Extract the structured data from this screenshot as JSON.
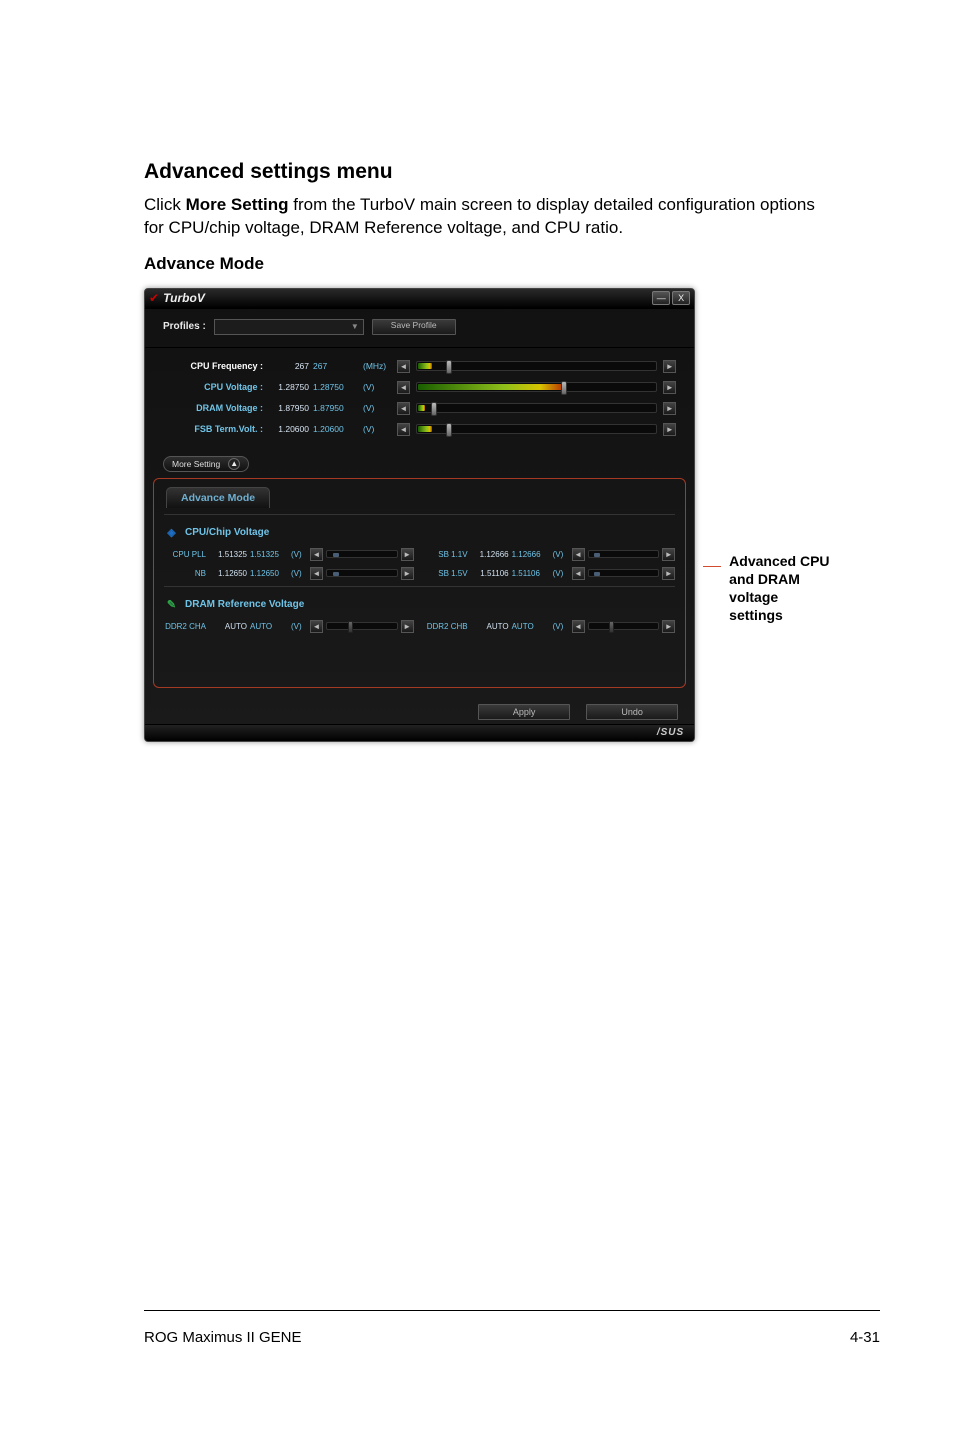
{
  "page": {
    "heading": "Advanced settings menu",
    "desc_prefix": "Click ",
    "desc_strong": "More Setting",
    "desc_suffix": " from the TurboV main screen to display detailed configuration options for CPU/chip voltage, DRAM Reference voltage, and CPU ratio.",
    "sub_heading": "Advance Mode",
    "callout": "Advanced CPU and DRAM voltage settings",
    "footer_left": "ROG Maximus II GENE",
    "footer_right": "4-31"
  },
  "titlebar": {
    "title": "TurboV",
    "minimize": "—",
    "close": "X"
  },
  "profiles": {
    "label": "Profiles :",
    "save_label": "Save Profile"
  },
  "main_rows": [
    {
      "label": "CPU Frequency :",
      "val": "267",
      "val2": "267",
      "unit": "(MHz)",
      "fill": 6,
      "thumb": 12
    },
    {
      "label": "CPU Voltage :",
      "val": "1.28750",
      "val2": "1.28750",
      "unit": "(V)",
      "fill": 60,
      "thumb": 60
    },
    {
      "label": "DRAM Voltage :",
      "val": "1.87950",
      "val2": "1.87950",
      "unit": "(V)",
      "fill": 3,
      "thumb": 6
    },
    {
      "label": "FSB Term.Volt. :",
      "val": "1.20600",
      "val2": "1.20600",
      "unit": "(V)",
      "fill": 6,
      "thumb": 12
    }
  ],
  "more_setting": {
    "label": "More Setting",
    "arrow": "▲"
  },
  "advance": {
    "tab_label": "Advance Mode",
    "cpu_group": {
      "title": "CPU/Chip Voltage",
      "rows": [
        [
          {
            "name": "CPU PLL",
            "val": "1.51325",
            "val2": "1.51325",
            "unit": "(V)",
            "thumb": 10
          },
          {
            "name": "SB 1.1V",
            "val": "1.12666",
            "val2": "1.12666",
            "unit": "(V)",
            "thumb": 10
          }
        ],
        [
          {
            "name": "NB",
            "val": "1.12650",
            "val2": "1.12650",
            "unit": "(V)",
            "thumb": 10
          },
          {
            "name": "SB 1.5V",
            "val": "1.51106",
            "val2": "1.51106",
            "unit": "(V)",
            "thumb": 10
          }
        ]
      ]
    },
    "dram_group": {
      "title": "DRAM Reference Voltage",
      "rows": [
        [
          {
            "name": "DDR2 CHA",
            "val": "AUTO",
            "val2": "AUTO",
            "unit": "(V)",
            "thumb": 30
          },
          {
            "name": "DDR2 CHB",
            "val": "AUTO",
            "val2": "AUTO",
            "unit": "(V)",
            "thumb": 30
          }
        ]
      ]
    }
  },
  "footer_buttons": {
    "apply": "Apply",
    "undo": "Undo"
  },
  "brand": "/SUS"
}
